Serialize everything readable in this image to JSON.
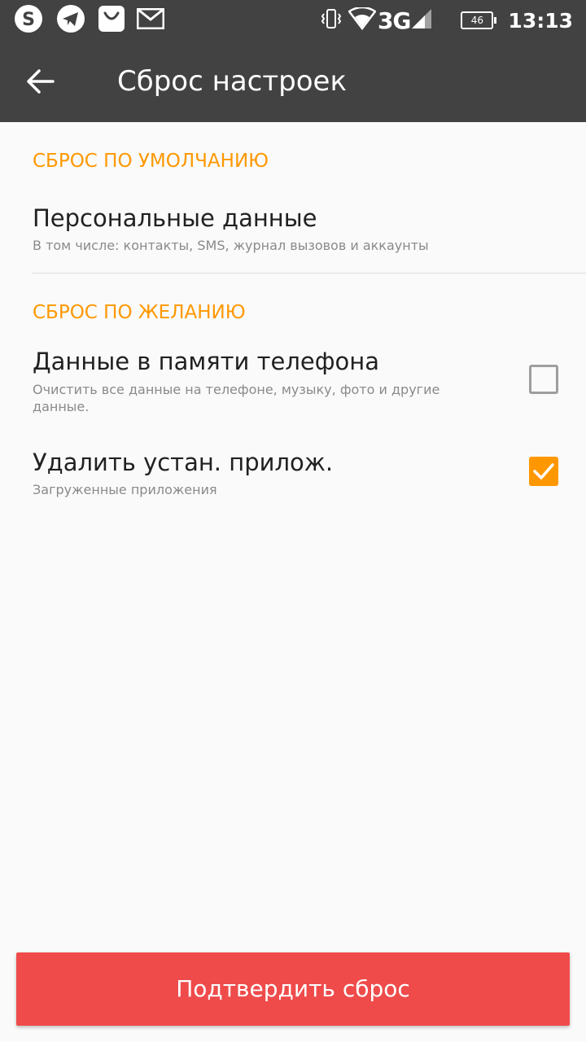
{
  "status_bar": {
    "left_icons": [
      "skype-icon",
      "telegram-icon",
      "shop-icon",
      "mail-icon"
    ],
    "right_icons": [
      "vibrate-icon",
      "wifi-icon",
      "signal-icon"
    ],
    "network": "3G",
    "battery": "46",
    "time": "13:13"
  },
  "app_bar": {
    "title": "Сброс настроек"
  },
  "colors": {
    "app_bar": "#424242",
    "accent": "#ff9800",
    "confirm": "#ef4b4b"
  },
  "default_section": {
    "header": "СБРОС ПО УМОЛЧАНИЮ",
    "items": [
      {
        "title": "Персональные данные",
        "subtitle": "В том числе: контакты, SMS, журнал вызовов и аккаунты"
      }
    ]
  },
  "optional_section": {
    "header": "СБРОС ПО ЖЕЛАНИЮ",
    "items": [
      {
        "title": "Данные в памяти телефона",
        "subtitle": "Очистить все данные на телефоне, музыку, фото и другие данные.",
        "checked": false
      },
      {
        "title": "Удалить устан. прилож.",
        "subtitle": "Загруженные приложения",
        "checked": true
      }
    ]
  },
  "confirm_button": {
    "label": "Подтвердить сброс"
  }
}
